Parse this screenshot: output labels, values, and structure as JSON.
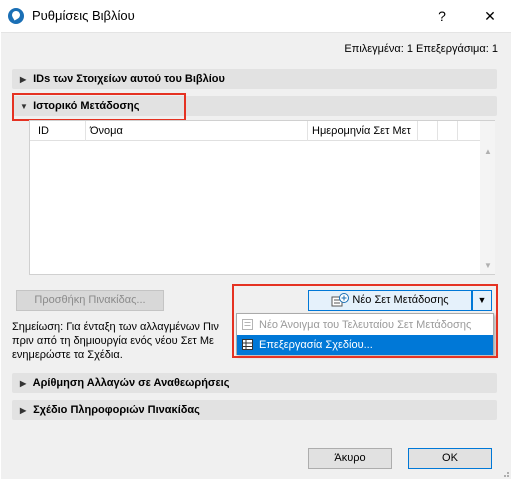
{
  "window": {
    "title": "Ρυθμίσεις Βιβλίου",
    "help_label": "?",
    "close_label": "✕"
  },
  "selection_info": "Επιλεγμένα: 1 Επεξεργάσιμα: 1",
  "sections": {
    "ids": "IDs των Στοιχείων αυτού του Βιβλίου",
    "history": "Ιστορικό Μετάδοσης",
    "numbering": "Αρίθμηση Αλλαγών σε Αναθεωρήσεις",
    "title_block": "Σχέδιο Πληροφοριών Πινακίδας"
  },
  "table": {
    "columns": [
      "ID",
      "Όνομα",
      "Ημερομηνία Σετ Μετ"
    ]
  },
  "buttons": {
    "add_title_block": "Προσθήκη Πινακίδας...",
    "new_set": "Νέο Σετ Μετάδοσης",
    "cancel": "Άκυρο",
    "ok": "OK"
  },
  "note_lines": [
    "Σημείωση: Για ένταξη των αλλαγμένων Πιν",
    "πριν από τη δημιουργία ενός νέου Σετ Με",
    "ενημερώστε τα Σχέδια."
  ],
  "dropdown": {
    "items": [
      {
        "label": "Νέο Άνοιγμα του Τελευταίου Σετ Μετάδοσης",
        "disabled": true
      },
      {
        "label": "Επεξεργασία Σχεδίου...",
        "highlighted": true
      }
    ]
  },
  "colors": {
    "highlight": "#0078d7",
    "callout": "#e53222",
    "accent_icon": "#1a6fb5"
  }
}
